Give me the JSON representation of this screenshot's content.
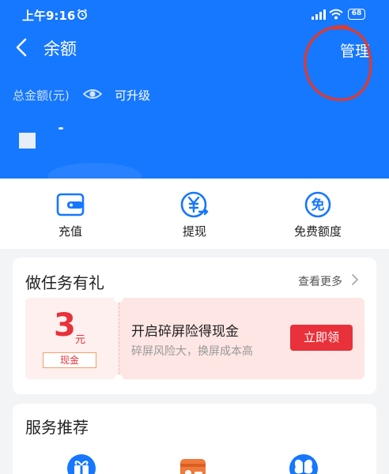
{
  "status_bar": {
    "time": "上午9:16",
    "battery": "68"
  },
  "header": {
    "title": "余额",
    "manage": "管理",
    "total_label": "总金额(元)",
    "upgrade": "可升级"
  },
  "actions": [
    {
      "label": "充值",
      "icon": "wallet-icon"
    },
    {
      "label": "提现",
      "icon": "yuan-transfer-icon"
    },
    {
      "label": "免费额度",
      "icon": "free-icon"
    }
  ],
  "task_card": {
    "title": "做任务有礼",
    "see_more": "查看更多",
    "reward_value": "3",
    "reward_unit": "元",
    "reward_tag": "现金",
    "task_title": "开启碎屏险得现金",
    "task_subtitle": "碎屏风险大，换屏成本高",
    "claim": "立即领"
  },
  "services": {
    "title": "服务推荐"
  },
  "colors": {
    "brand_blue": "#1677ff",
    "accent_red": "#e8313a",
    "annotation_red": "#e23a2c"
  },
  "icon_glyphs": {
    "free": "免"
  }
}
